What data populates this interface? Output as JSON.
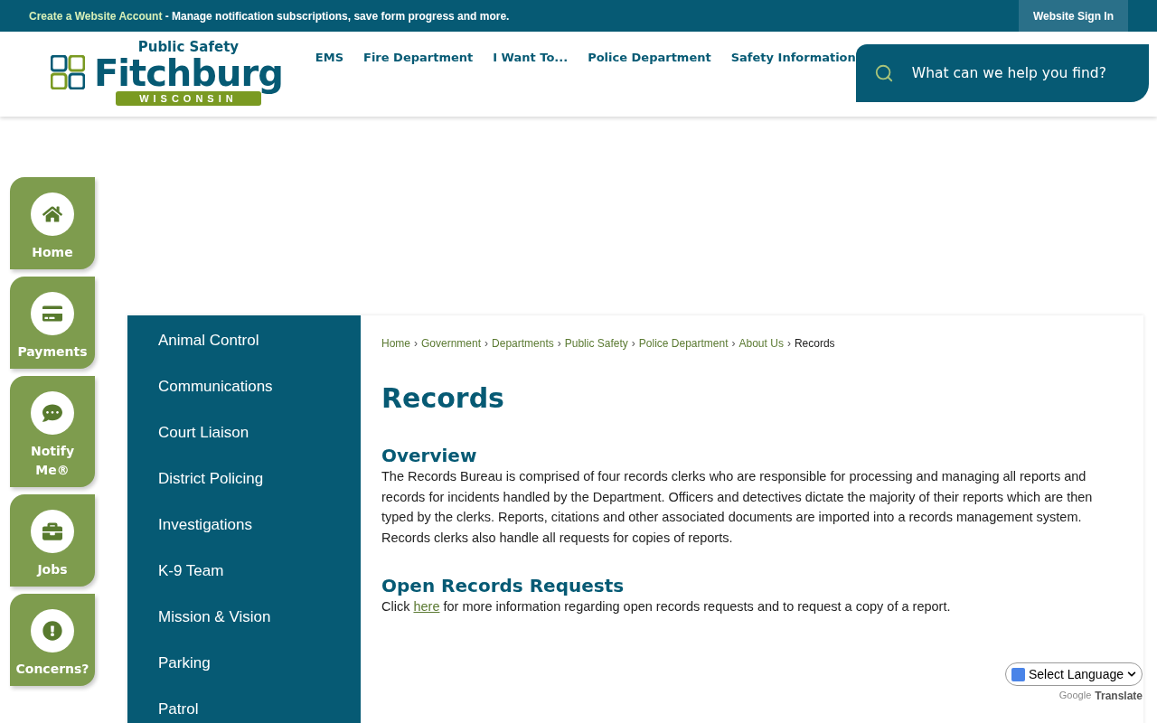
{
  "top_bar": {
    "account_link": "Create a Website Account",
    "account_text": " - Manage notification subscriptions, save form progress and more.",
    "sign_in": "Website Sign In"
  },
  "logo": {
    "top": "Public Safety",
    "main": "Fitchburg",
    "bottom": "WISCONSIN"
  },
  "nav": [
    "EMS",
    "Fire Department",
    "I Want To...",
    "Police Department",
    "Safety Information"
  ],
  "search": {
    "placeholder": "What can we help you find?"
  },
  "quick_links": [
    {
      "kind": "home",
      "label": "Home"
    },
    {
      "kind": "payments",
      "label": "Payments"
    },
    {
      "kind": "notify",
      "label": "Notify Me®"
    },
    {
      "kind": "jobs",
      "label": "Jobs"
    },
    {
      "kind": "concerns",
      "label": "Concerns?"
    }
  ],
  "side_menu": [
    "Animal Control",
    "Communications",
    "Court Liaison",
    "District Policing",
    "Investigations",
    "K-9 Team",
    "Mission & Vision",
    "Parking",
    "Patrol"
  ],
  "breadcrumb": {
    "separator": "›",
    "links": [
      "Home",
      "Government",
      "Departments",
      "Public Safety",
      "Police Department",
      "About Us"
    ],
    "current": "Records"
  },
  "title": "Records",
  "sections": [
    {
      "heading": "Overview",
      "before": "The Records Bureau is comprised of four records clerks who are responsible for processing and managing all reports and records for incidents handled by the Department. Officers and detectives dictate the majority of their reports which are then typed by the clerks. Reports, citations and other associated documents are imported into a records management system. Records clerks also handle all requests for copies of reports."
    },
    {
      "heading": "Open Records Requests",
      "before": "Click ",
      "link": "here",
      "after": " for more information regarding open records requests and to request a copy of a report."
    }
  ],
  "translate": {
    "select": "Select Language",
    "brand": "Google",
    "label": "Translate"
  }
}
